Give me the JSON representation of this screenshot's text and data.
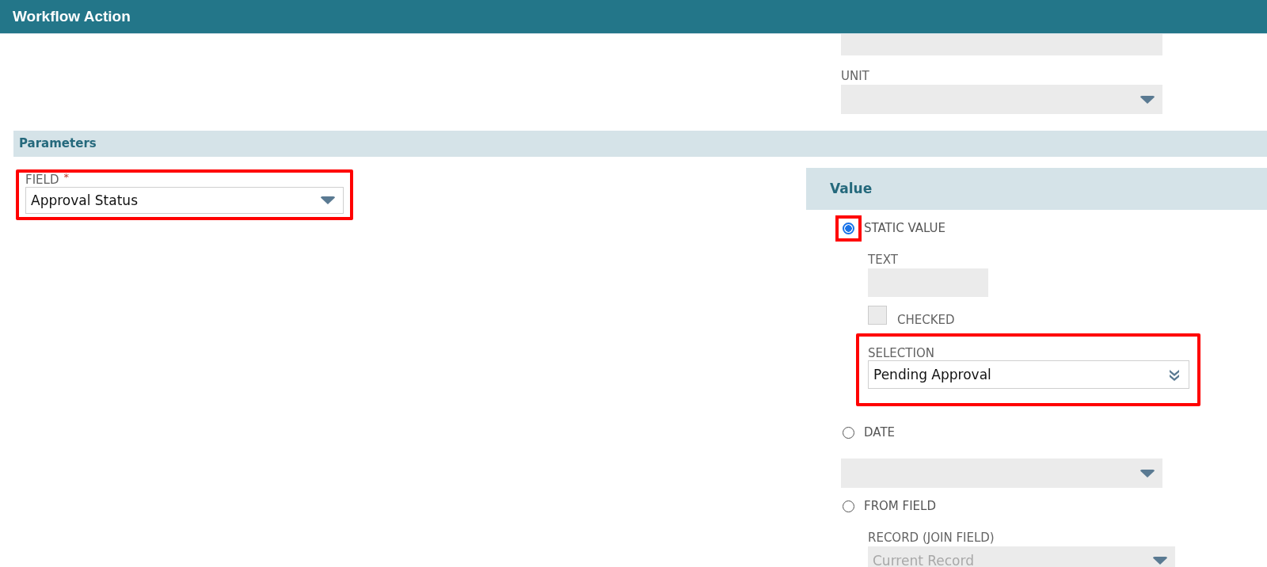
{
  "window": {
    "title": "Workflow Action"
  },
  "top_section": {
    "unit": {
      "label": "UNIT"
    }
  },
  "parameters": {
    "title": "Parameters"
  },
  "field": {
    "label": "FIELD",
    "required_mark": "*",
    "value": "Approval Status",
    "highlighted": true
  },
  "value_panel": {
    "title": "Value",
    "options": [
      {
        "kind": "static",
        "label": "STATIC VALUE",
        "selected": true,
        "highlighted": true,
        "text_label": "TEXT",
        "checkbox": {
          "label": "CHECKED",
          "checked": false
        },
        "selection": {
          "label": "SELECTION",
          "value": "Pending Approval",
          "highlighted": true
        }
      },
      {
        "kind": "date",
        "label": "DATE",
        "selected": false,
        "highlighted": false
      },
      {
        "kind": "from_field",
        "label": "FROM FIELD",
        "selected": false,
        "highlighted": false,
        "record": {
          "label": "RECORD (JOIN FIELD)",
          "value": "Current Record",
          "disabled": true
        }
      }
    ]
  }
}
